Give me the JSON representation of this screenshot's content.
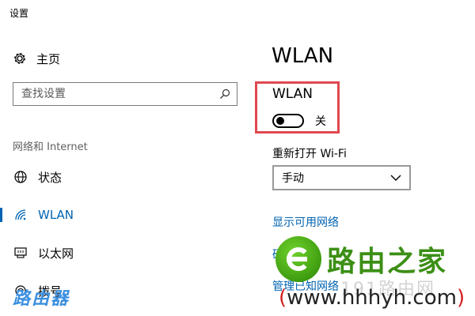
{
  "window": {
    "title": "设置"
  },
  "sidebar": {
    "home": {
      "label": "主页",
      "icon": "gear-icon"
    },
    "search": {
      "placeholder": "查找设置",
      "icon": "search-icon"
    },
    "section_label": "网络和 Internet",
    "items": [
      {
        "label": "状态",
        "icon": "globe-icon",
        "selected": false
      },
      {
        "label": "WLAN",
        "icon": "wifi-icon",
        "selected": true
      },
      {
        "label": "以太网",
        "icon": "ethernet-icon",
        "selected": false
      },
      {
        "label": "拨号",
        "icon": "dialup-icon",
        "selected": false
      }
    ]
  },
  "main": {
    "title": "WLAN",
    "wlan_toggle": {
      "label": "WLAN",
      "state_text": "关",
      "on": false
    },
    "reopen": {
      "label": "重新打开 Wi-Fi",
      "selected": "手动"
    },
    "links": {
      "show_networks": "显示可用网络",
      "hardware": "硬",
      "manage": "管理已知网络"
    }
  },
  "watermark": {
    "brand": "路由之家",
    "faint": "191路由网",
    "url_open": "(",
    "url": "www.hhhyh.com",
    "url_close": ")",
    "corner": "路由器"
  },
  "colors": {
    "accent": "#0063b1",
    "highlight_box": "#e04850",
    "brand_green": "#3c8f15"
  }
}
